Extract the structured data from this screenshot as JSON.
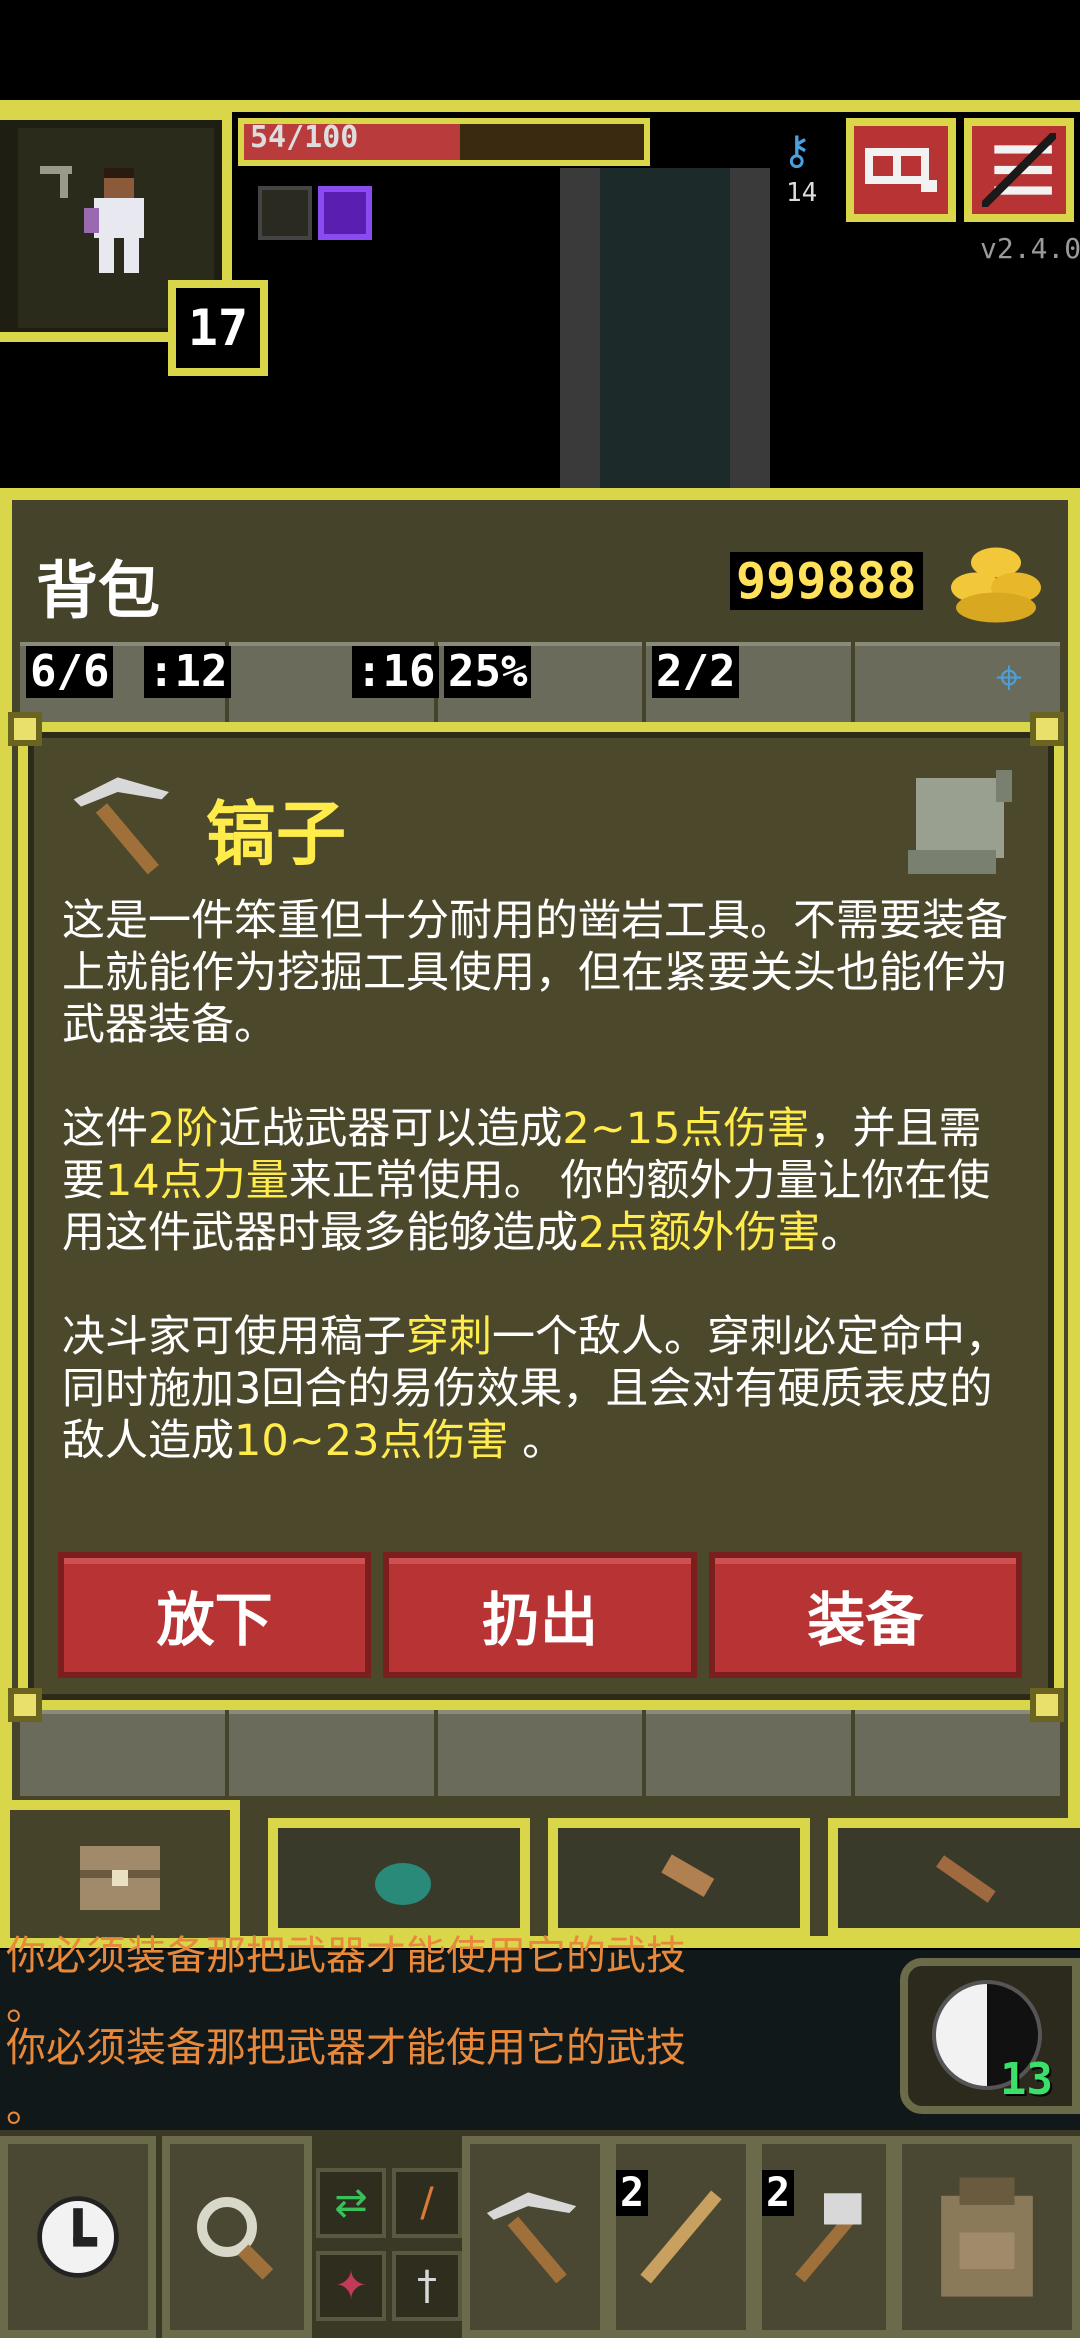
{
  "hud": {
    "hp_text": "54/100",
    "hp_fraction": 0.54,
    "level": "17",
    "key_count": "14",
    "version": "v2.4.0",
    "journal_icon": "journal-icon",
    "menu_icon": "menu-icon"
  },
  "backpack": {
    "title": "背包",
    "gold": "999888",
    "slot_labels": [
      "6/6",
      ":12",
      ":16",
      "25%",
      "2/2"
    ]
  },
  "item": {
    "name": "镐子",
    "description_1": "这是一件笨重但十分耐用的凿岩工具。不需要装备上就能作为挖掘工具使用，但在紧要关头也能作为武器装备。",
    "d2_a": "这件",
    "d2_tier": "2阶",
    "d2_b": "近战武器可以造成",
    "d2_dmg": "2~15点伤害",
    "d2_c": "，并且需要",
    "d2_str": "14点力量",
    "d2_d": "来正常使用。 你的额外力量让你在使用这件武器时最多能够造成",
    "d2_bonus": "2点额外伤害",
    "d2_e": "。",
    "d3_a": "决斗家可使用稿子",
    "d3_pierce": "穿刺",
    "d3_b": "一个敌人。穿刺必定命中，同时施加3回合的易伤效果，且会对有硬质表皮的敌人造成",
    "d3_dmg": "10~23点伤害",
    "d3_c": " 。",
    "buttons": {
      "drop": "放下",
      "throw": "扔出",
      "equip": "装备"
    }
  },
  "log": [
    "你必须装备那把武器才能使用它的武技",
    "。",
    "你必须装备那把武器才能使用它的武技",
    "。"
  ],
  "ability": {
    "count": "13"
  },
  "quickslots": {
    "qty_1": "2",
    "qty_2": "2"
  },
  "colors": {
    "frame": "#d9d64a",
    "button_red": "#b83434",
    "highlight": "#ffec4a",
    "log_text": "#e8883a"
  }
}
